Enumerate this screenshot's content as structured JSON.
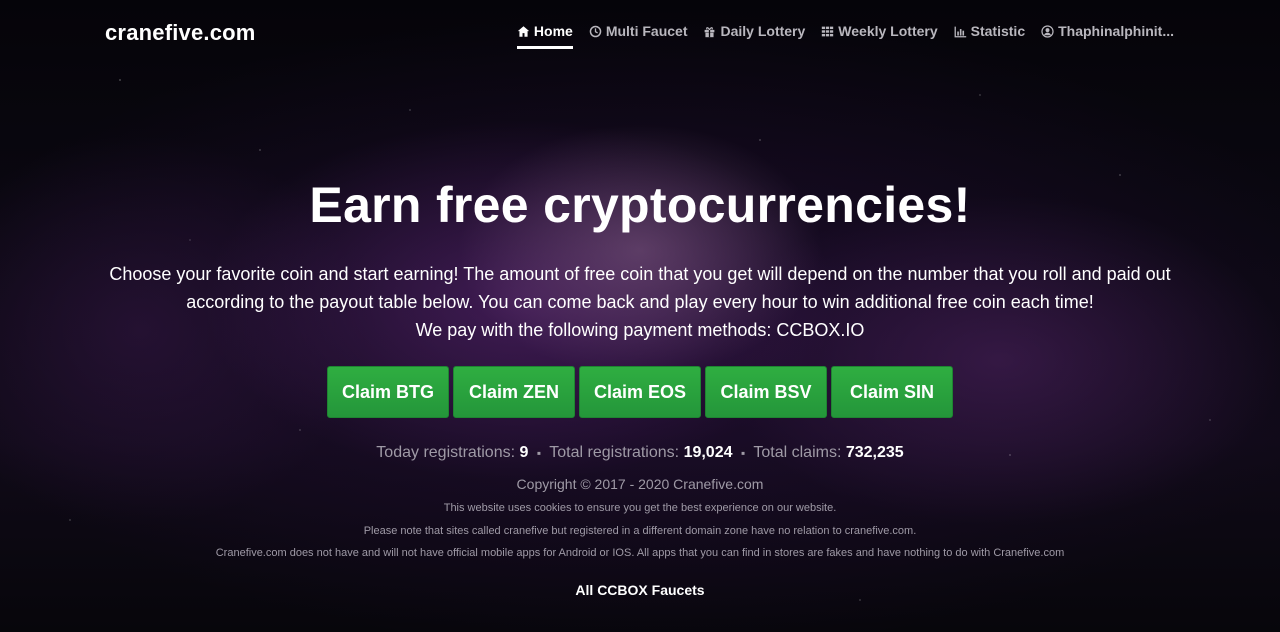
{
  "header": {
    "brand": "cranefive.com",
    "nav": [
      {
        "label": "Home",
        "icon": "home-icon",
        "active": true
      },
      {
        "label": "Multi Faucet",
        "icon": "clock-icon",
        "active": false
      },
      {
        "label": "Daily Lottery",
        "icon": "gift-icon",
        "active": false
      },
      {
        "label": "Weekly Lottery",
        "icon": "grid-icon",
        "active": false
      },
      {
        "label": "Statistic",
        "icon": "bar-chart-icon",
        "active": false
      },
      {
        "label": "Thaphinalphinit...",
        "icon": "user-circle-icon",
        "active": false
      }
    ]
  },
  "hero": {
    "title": "Earn free cryptocurrencies!",
    "line1": "Choose your favorite coin and start earning! The amount of free coin that you get will depend on the number that you roll and paid out",
    "line2": "according to the payout table below. You can come back and play every hour to win additional free coin each time!",
    "line3": "We pay with the following payment methods: CCBOX.IO"
  },
  "buttons": [
    {
      "label": "Claim BTG"
    },
    {
      "label": "Claim ZEN"
    },
    {
      "label": "Claim EOS"
    },
    {
      "label": "Claim BSV"
    },
    {
      "label": "Claim SIN"
    }
  ],
  "stats": {
    "today_label": "Today registrations:",
    "today_value": "9",
    "total_reg_label": "Total registrations:",
    "total_reg_value": "19,024",
    "total_claims_label": "Total claims:",
    "total_claims_value": "732,235",
    "separator": "▪"
  },
  "footer": {
    "copyright": "Copyright © 2017 - 2020 Cranefive.com",
    "note1": "This website uses cookies to ensure you get the best experience on our website.",
    "note2": "Please note that sites called cranefive but registered in a different domain zone have no relation to cranefive.com.",
    "note3": "Cranefive.com does not have and will not have official mobile apps for Android or IOS. All apps that you can find in stores are fakes and have nothing to do with Cranefive.com",
    "all_faucets": "All CCBOX Faucets"
  },
  "colors": {
    "button_green": "#28a03a",
    "nav_inactive": "#b9b7be",
    "muted_text": "#9f9aa6"
  }
}
